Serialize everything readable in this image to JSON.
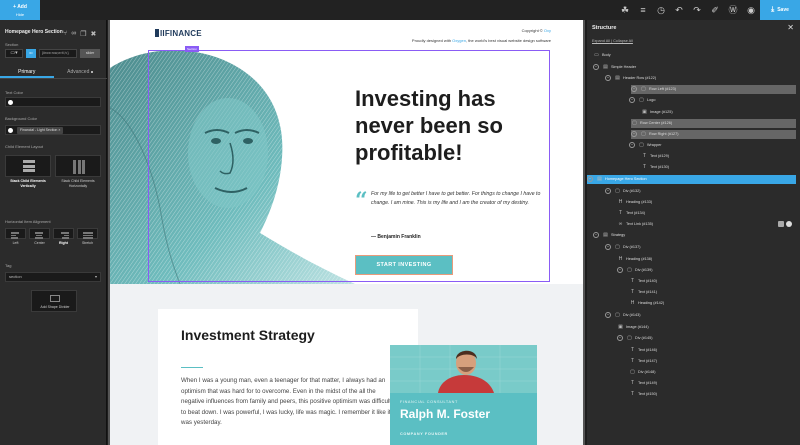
{
  "topbar": {
    "add_label": "Add",
    "hide_label": "Hide",
    "save_label": "Save",
    "icons": [
      "bug-icon",
      "stack-icon",
      "history-icon",
      "undo-icon",
      "redo-icon",
      "brush-icon",
      "wordpress-icon",
      "eye-icon"
    ]
  },
  "left_panel": {
    "title": "Homepage Hero Section",
    "section_label": "Section",
    "element_id": "ID",
    "code_value": "{#row:row,w:tt,h:}",
    "slug": "slider",
    "tabs": [
      "Primary",
      "Advanced"
    ],
    "text_color_label": "Text Color",
    "text_color_value": "#ffffff",
    "bg_color_label": "Background Color",
    "bg_color_chip": "Financial - Light Section",
    "layout_label": "Child Element Layout",
    "layout_options": [
      "Stack Child Elements Vertically",
      "Stack Child Elements Horizontally"
    ],
    "h_align_label": "Horizontal Item Alignment",
    "h_align_options": [
      "Left",
      "Center",
      "Right",
      "Stretch"
    ],
    "tag_label": "Tag",
    "tag_value": "section",
    "shape_divider_label": "Add Shape Divider"
  },
  "canvas": {
    "header": {
      "logo": "IIFINANCE",
      "copyright_prefix": "Copyright ©",
      "copyright_link": "Oxy",
      "proudly_prefix": "Proudly designed with",
      "proudly_link": "Oxygen",
      "proudly_suffix": ", the world's best visual website design software"
    },
    "hero": {
      "selection_tag": "Section",
      "headline": "Investing has never been so profitable!",
      "quote": "For my life to get better I have to get better. For things to change I have to change. I am mine. This is my life and I am the creator of my destiny.",
      "quote_author": "— Benjamin Franklin",
      "cta": "START INVESTING"
    },
    "strategy": {
      "title": "Investment Strategy",
      "text": "When I was a young man, even a teenager for that matter, I always had an optimism that was hard for to overcome. Even in the midst of the all the negative influences from family and peers, this positive optimism was difficult to beat down. I was powerful, I was lucky, life was magic. I remember it like it was yesterday."
    },
    "profile": {
      "role": "FINANCIAL CONSULTANT",
      "name": "Ralph M. Foster",
      "role2": "COMPANY FOUNDER"
    }
  },
  "right_panel": {
    "title": "Structure",
    "expand_all": "Expand All",
    "collapse_all": "Collapse All",
    "nodes": [
      {
        "label": "Body",
        "icon": "body-icon",
        "state": ""
      },
      {
        "label": "Simple Header",
        "icon": "header-icon",
        "state": ""
      },
      {
        "label": "Header Row (#122)",
        "icon": "row-icon",
        "state": ""
      },
      {
        "label": "Row Left (#123)",
        "icon": "div-icon",
        "state": "hl"
      },
      {
        "label": "Logo",
        "icon": "div-icon",
        "state": ""
      },
      {
        "label": "Image (#125)",
        "icon": "image-icon",
        "state": ""
      },
      {
        "label": "Row Center (#126)",
        "icon": "div-icon",
        "state": "hl"
      },
      {
        "label": "Row Right (#127)",
        "icon": "div-icon",
        "state": "hl"
      },
      {
        "label": "Wrapper",
        "icon": "div-icon",
        "state": ""
      },
      {
        "label": "Text (#129)",
        "icon": "text-icon",
        "state": ""
      },
      {
        "label": "Text (#130)",
        "icon": "text-icon",
        "state": ""
      },
      {
        "label": "Homepage Hero Section",
        "icon": "section-icon",
        "state": "sel"
      },
      {
        "label": "Div (#132)",
        "icon": "div-icon",
        "state": ""
      },
      {
        "label": "Heading (#133)",
        "icon": "heading-icon",
        "state": ""
      },
      {
        "label": "Text (#134)",
        "icon": "text-icon",
        "state": ""
      },
      {
        "label": "Text Link (#135)",
        "icon": "link-icon",
        "state": ""
      },
      {
        "label": "Strategy",
        "icon": "section-icon",
        "state": ""
      },
      {
        "label": "Div (#137)",
        "icon": "div-icon",
        "state": ""
      },
      {
        "label": "Heading (#138)",
        "icon": "heading-icon",
        "state": ""
      },
      {
        "label": "Div (#139)",
        "icon": "div-icon",
        "state": ""
      },
      {
        "label": "Text (#140)",
        "icon": "text-icon",
        "state": ""
      },
      {
        "label": "Text (#141)",
        "icon": "text-icon",
        "state": ""
      },
      {
        "label": "Heading (#142)",
        "icon": "heading-icon",
        "state": ""
      },
      {
        "label": "Div (#143)",
        "icon": "div-icon",
        "state": ""
      },
      {
        "label": "Image (#144)",
        "icon": "image-icon",
        "state": ""
      },
      {
        "label": "Div (#145)",
        "icon": "div-icon",
        "state": ""
      },
      {
        "label": "Text (#146)",
        "icon": "text-icon",
        "state": ""
      },
      {
        "label": "Text (#147)",
        "icon": "text-icon",
        "state": ""
      },
      {
        "label": "Div (#148)",
        "icon": "div-icon",
        "state": ""
      },
      {
        "label": "Text (#149)",
        "icon": "text-icon",
        "state": ""
      },
      {
        "label": "Text (#150)",
        "icon": "text-icon",
        "state": ""
      }
    ]
  },
  "colors": {
    "accent": "#39a7e6",
    "teal": "#5bbfc3",
    "selection": "#8a5cf5",
    "panel": "#2b2b2b"
  }
}
